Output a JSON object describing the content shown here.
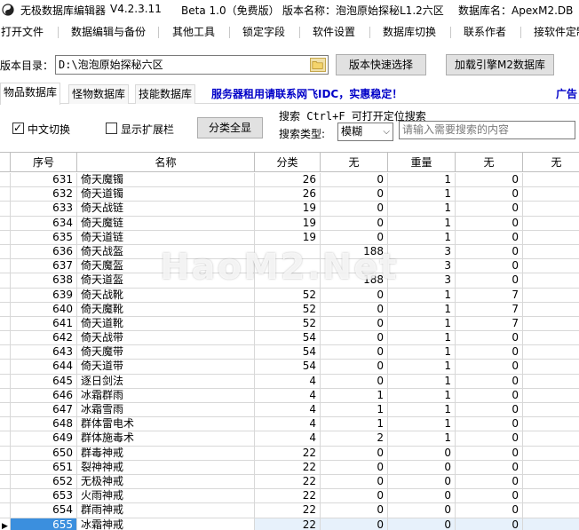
{
  "title": {
    "app_name": "无极数据库编辑器",
    "version": "V4.2.3.11",
    "beta": "Beta 1.0（免费版）",
    "edition_label": "版本名称：泡泡原始探秘L1.2六区",
    "db_label": "数据库名：ApexM2.DB"
  },
  "menu": [
    "打开文件",
    "数据编辑与备份",
    "其他工具",
    "锁定字段",
    "软件设置",
    "数据库切换",
    "联系作者",
    "接软件定制"
  ],
  "path": {
    "label": "版本目录：",
    "value": "D:\\泡泡原始探秘六区",
    "quick_select_label": "版本快速选择",
    "load_engine_label": "加载引擎M2数据库"
  },
  "tabs": {
    "items": [
      "物品数据库",
      "怪物数据库",
      "技能数据库"
    ],
    "active": "物品数据库",
    "ad_text": "服务器租用请联系网飞IDC，实惠稳定！",
    "ad_label": "广告"
  },
  "filters": {
    "chinese_toggle_label": "中文切换",
    "chinese_toggle_checked": true,
    "show_ext_label": "显示扩展栏",
    "show_ext_checked": false,
    "show_all_label": "分类全显",
    "search_hint": "搜索  Ctrl+F 可打开定位搜索",
    "search_type_label": "搜索类型:",
    "search_type_value": "模糊",
    "search_placeholder": "请输入需要搜索的内容"
  },
  "table": {
    "headers": [
      "序号",
      "名称",
      "分类",
      "无",
      "重量",
      "无",
      "无"
    ],
    "rows": [
      [
        "631",
        "倚天魔镯",
        "26",
        "0",
        "1",
        "0"
      ],
      [
        "632",
        "倚天道镯",
        "26",
        "0",
        "1",
        "0"
      ],
      [
        "633",
        "倚天战链",
        "19",
        "0",
        "1",
        "0"
      ],
      [
        "634",
        "倚天魔链",
        "19",
        "0",
        "1",
        "0"
      ],
      [
        "635",
        "倚天道链",
        "19",
        "0",
        "1",
        "0"
      ],
      [
        "636",
        "倚天战盔",
        "",
        "188",
        "3",
        "0"
      ],
      [
        "637",
        "倚天魔盔",
        "",
        "",
        "3",
        "0"
      ],
      [
        "638",
        "倚天道盔",
        "",
        "188",
        "3",
        "0"
      ],
      [
        "639",
        "倚天战靴",
        "52",
        "0",
        "1",
        "7"
      ],
      [
        "640",
        "倚天魔靴",
        "52",
        "0",
        "1",
        "7"
      ],
      [
        "641",
        "倚天道靴",
        "52",
        "0",
        "1",
        "7"
      ],
      [
        "642",
        "倚天战带",
        "54",
        "0",
        "1",
        "0"
      ],
      [
        "643",
        "倚天魔带",
        "54",
        "0",
        "1",
        "0"
      ],
      [
        "644",
        "倚天道带",
        "54",
        "0",
        "1",
        "0"
      ],
      [
        "645",
        "逐日剑法",
        "4",
        "0",
        "1",
        "0"
      ],
      [
        "646",
        "冰霜群雨",
        "4",
        "1",
        "1",
        "0"
      ],
      [
        "647",
        "冰霜雪雨",
        "4",
        "1",
        "1",
        "0"
      ],
      [
        "648",
        "群体雷电术",
        "4",
        "1",
        "1",
        "0"
      ],
      [
        "649",
        "群体施毒术",
        "4",
        "2",
        "1",
        "0"
      ],
      [
        "650",
        "群毒神戒",
        "22",
        "0",
        "0",
        "0"
      ],
      [
        "651",
        "裂神神戒",
        "22",
        "0",
        "0",
        "0"
      ],
      [
        "652",
        "无极神戒",
        "22",
        "0",
        "0",
        "0"
      ],
      [
        "653",
        "火雨神戒",
        "22",
        "0",
        "0",
        "0"
      ],
      [
        "654",
        "群雨神戒",
        "22",
        "0",
        "0",
        "0"
      ],
      [
        "655",
        "冰霜神戒",
        "22",
        "0",
        "0",
        "0"
      ]
    ],
    "selected_row": "655"
  },
  "watermark": "HaoM2.Net"
}
